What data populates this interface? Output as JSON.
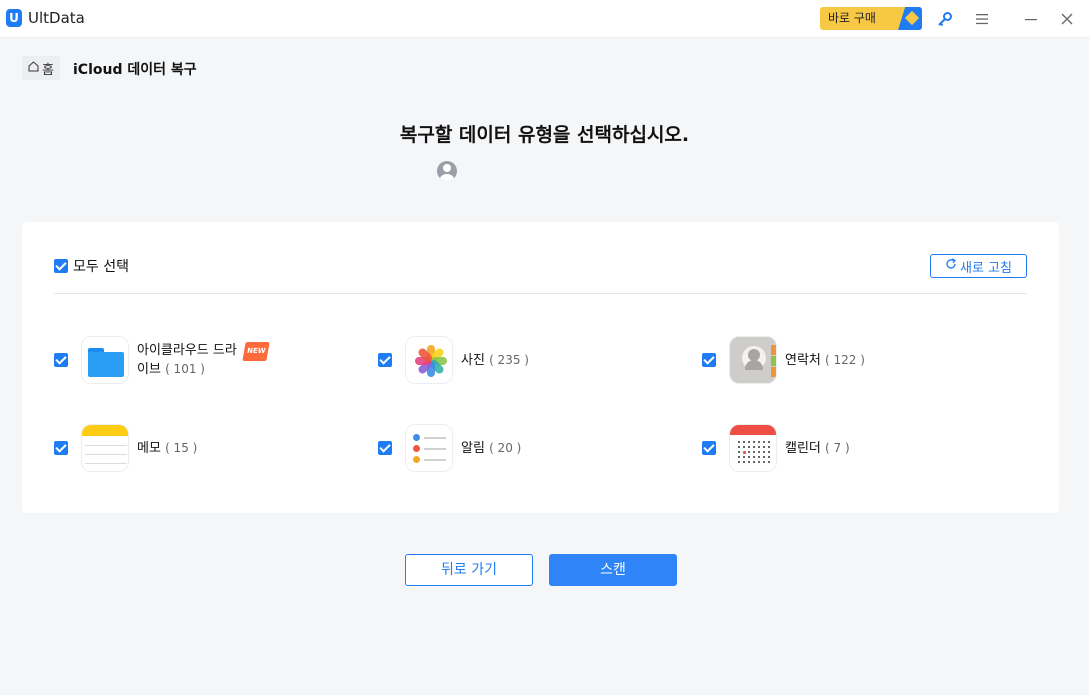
{
  "app": {
    "title": "UltData",
    "logo_letter": "U",
    "buy_label": "바로 구매",
    "accent": "#1f7cf5",
    "buy_color": "#f7c843"
  },
  "titlebar_icons": [
    "key-icon",
    "menu-icon",
    "minimize-icon",
    "close-icon"
  ],
  "breadcrumb": {
    "home_label": "홈",
    "title": "iCloud 데이터 복구"
  },
  "main": {
    "heading": "복구할 데이터 유형을 선택하십시오."
  },
  "card": {
    "select_all_label": "모두 선택",
    "select_all_checked": true,
    "refresh_label": "새로 고침",
    "items": [
      {
        "label": "아이클라우드 드라",
        "label2": "이브",
        "count": "( 101 )",
        "badge": "NEW",
        "icon": "icloud-drive-icon",
        "checked": true
      },
      {
        "label": "사진",
        "count": "( 235 )",
        "icon": "photos-icon",
        "checked": true
      },
      {
        "label": "연락처",
        "count": "( 122 )",
        "icon": "contacts-icon",
        "checked": true
      },
      {
        "label": "메모",
        "count": "( 15 )",
        "icon": "notes-icon",
        "checked": true
      },
      {
        "label": "알림",
        "count": "( 20 )",
        "icon": "reminders-icon",
        "checked": true
      },
      {
        "label": "캘린더",
        "count": "( 7 )",
        "icon": "calendar-icon",
        "checked": true
      }
    ]
  },
  "footer": {
    "back_label": "뒤로 가기",
    "scan_label": "스캔"
  }
}
